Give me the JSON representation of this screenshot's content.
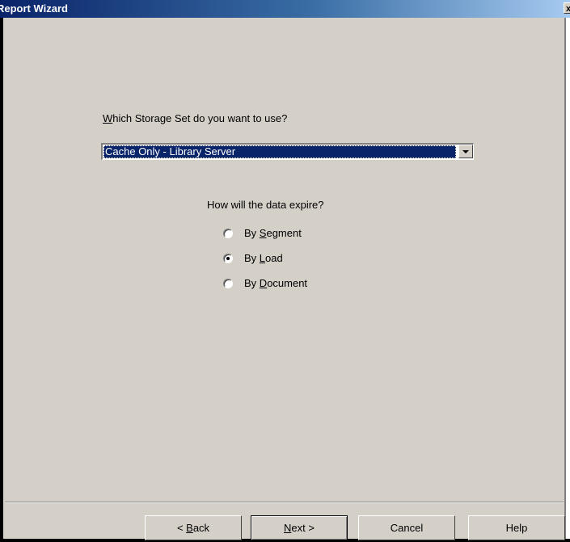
{
  "window": {
    "title": "Report Wizard",
    "close_glyph": "x"
  },
  "storage": {
    "question_mnemonic": "W",
    "question_rest": "hich Storage Set do you want to use?",
    "selected": "Cache Only - Library Server"
  },
  "expire": {
    "question": "How will the data expire?",
    "options": [
      {
        "pre": "By ",
        "key": "S",
        "post": "egment",
        "checked": false
      },
      {
        "pre": "By ",
        "key": "L",
        "post": "oad",
        "checked": true
      },
      {
        "pre": "By ",
        "key": "D",
        "post": "ocument",
        "checked": false
      }
    ]
  },
  "buttons": {
    "back": {
      "pre": "< ",
      "key": "B",
      "post": "ack"
    },
    "next": {
      "pre": "",
      "key": "N",
      "post": "ext >"
    },
    "cancel": "Cancel",
    "help": "Help"
  }
}
